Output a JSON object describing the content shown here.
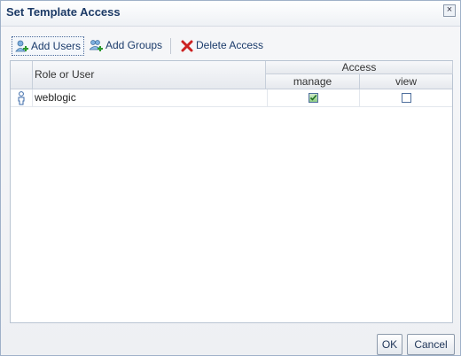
{
  "dialog": {
    "title": "Set Template Access"
  },
  "toolbar": {
    "add_users": "Add Users",
    "add_groups": "Add Groups",
    "delete_access": "Delete Access"
  },
  "table": {
    "col_role": "Role or User",
    "col_access": "Access",
    "col_manage": "manage",
    "col_view": "view",
    "rows": [
      {
        "name": "weblogic",
        "manage": true,
        "view": false
      }
    ]
  },
  "buttons": {
    "ok": "OK",
    "cancel": "Cancel"
  },
  "colors": {
    "title": "#1c3a66",
    "check_on": "#2e8b2e",
    "delete_x": "#cc2222"
  }
}
